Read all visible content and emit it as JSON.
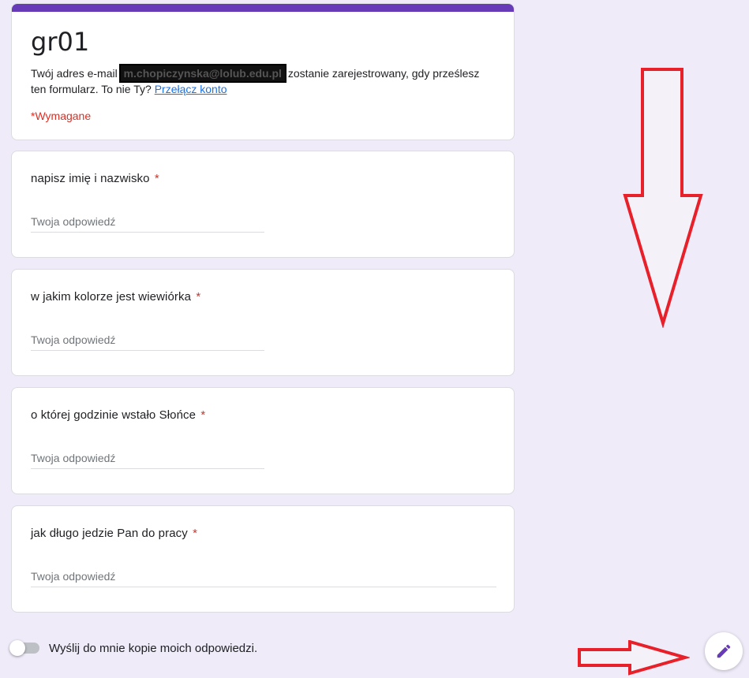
{
  "form": {
    "title": "gr01",
    "email_prefix": "Twój adres e-mail",
    "email_value": "m.chopiczynska@lolub.edu.pl",
    "email_suffix": "zostanie zarejestrowany, gdy prześlesz ten formularz. To nie Ty?",
    "switch_account": "Przełącz konto",
    "required_note": "*Wymagane"
  },
  "questions": [
    {
      "label": "napisz imię i nazwisko",
      "required_mark": "*",
      "placeholder": "Twoja odpowiedź"
    },
    {
      "label": "w jakim kolorze jest wiewiórka",
      "required_mark": "*",
      "placeholder": "Twoja odpowiedź"
    },
    {
      "label": "o której godzinie wstało Słońce",
      "required_mark": "*",
      "placeholder": "Twoja odpowiedź"
    },
    {
      "label": "jak długo jedzie Pan do pracy",
      "required_mark": "*",
      "placeholder": "Twoja odpowiedź"
    }
  ],
  "send_copy": {
    "label": "Wyślij do mnie kopie moich odpowiedzi.",
    "enabled": false
  },
  "icons": {
    "edit": "pencil-icon"
  },
  "colors": {
    "accent": "#673ab7",
    "background": "#efebf9",
    "required": "#d93025",
    "link": "#1a73e8",
    "annotation_arrow": "#e8202a"
  }
}
